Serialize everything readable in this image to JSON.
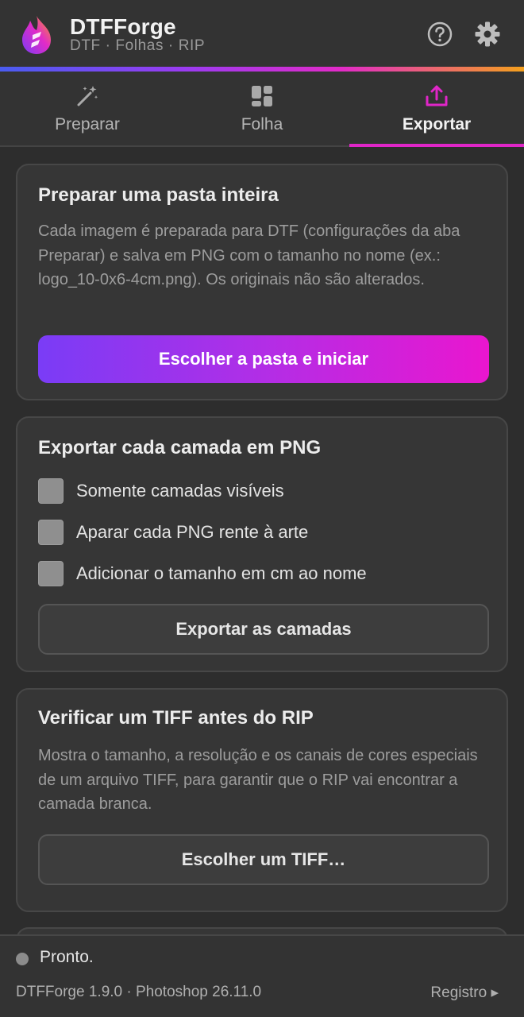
{
  "header": {
    "title": "DTFForge",
    "subtitle": "DTF · Folhas · RIP",
    "logo_icon": "flame-logo",
    "help_icon": "help-circle-icon",
    "settings_icon": "gear-icon"
  },
  "tabs": [
    {
      "label": "Preparar",
      "icon": "magic-wand-icon",
      "active": false
    },
    {
      "label": "Folha",
      "icon": "grid-icon",
      "active": false
    },
    {
      "label": "Exportar",
      "icon": "upload-icon",
      "active": true
    }
  ],
  "cards": {
    "folder": {
      "title": "Preparar uma pasta inteira",
      "description": "Cada imagem é preparada para DTF (configurações da aba Preparar) e salva em PNG com o tamanho no nome (ex.: logo_10-0x6-4cm.png). Os originais não são alterados.",
      "button": "Escolher a pasta e iniciar"
    },
    "layers": {
      "title": "Exportar cada camada em PNG",
      "options": [
        {
          "label": "Somente camadas visíveis",
          "checked": false
        },
        {
          "label": "Aparar cada PNG rente à arte",
          "checked": false
        },
        {
          "label": "Adicionar o tamanho em cm ao nome",
          "checked": false
        }
      ],
      "button": "Exportar as camadas"
    },
    "tiff": {
      "title": "Verificar um TIFF antes do RIP",
      "description": "Mostra o tamanho, a resolução e os canais de cores especiais de um arquivo TIFF, para garantir que o RIP vai encontrar a camada branca.",
      "button": "Escolher um TIFF…"
    }
  },
  "footer": {
    "status": "Pronto.",
    "version": "DTFForge 1.9.0 · Photoshop 26.11.0",
    "log_link": "Registro ▸"
  },
  "colors": {
    "accent_magenta": "#e026c8",
    "primary_gradient_start": "#7a3cf6",
    "primary_gradient_end": "#ea16cf",
    "background": "#2d2d2d"
  }
}
